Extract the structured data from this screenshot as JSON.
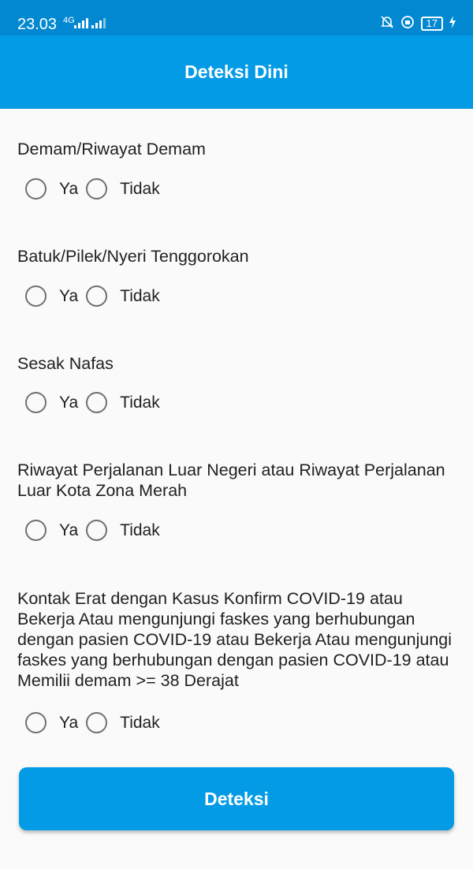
{
  "status_bar": {
    "time": "23.03",
    "network": "4G",
    "battery": "17"
  },
  "app_bar": {
    "title": "Deteksi Dini"
  },
  "questions": [
    {
      "text": "Demam/Riwayat Demam",
      "options": [
        "Ya",
        "Tidak"
      ]
    },
    {
      "text": "Batuk/Pilek/Nyeri Tenggorokan",
      "options": [
        "Ya",
        "Tidak"
      ]
    },
    {
      "text": "Sesak Nafas",
      "options": [
        "Ya",
        "Tidak"
      ]
    },
    {
      "text": "Riwayat Perjalanan Luar Negeri atau Riwayat Perjalanan Luar Kota Zona Merah",
      "options": [
        "Ya",
        "Tidak"
      ]
    },
    {
      "text": "Kontak Erat dengan Kasus Konfirm COVID-19 atau Bekerja Atau mengunjungi faskes yang berhubungan dengan pasien COVID-19 atau Bekerja Atau mengunjungi faskes yang berhubungan dengan pasien COVID-19 atau Memilii demam >= 38 Derajat",
      "options": [
        "Ya",
        "Tidak"
      ]
    }
  ],
  "submit_button": {
    "label": "Deteksi"
  },
  "colors": {
    "status_bar": "#0288d1",
    "primary": "#039be5"
  }
}
